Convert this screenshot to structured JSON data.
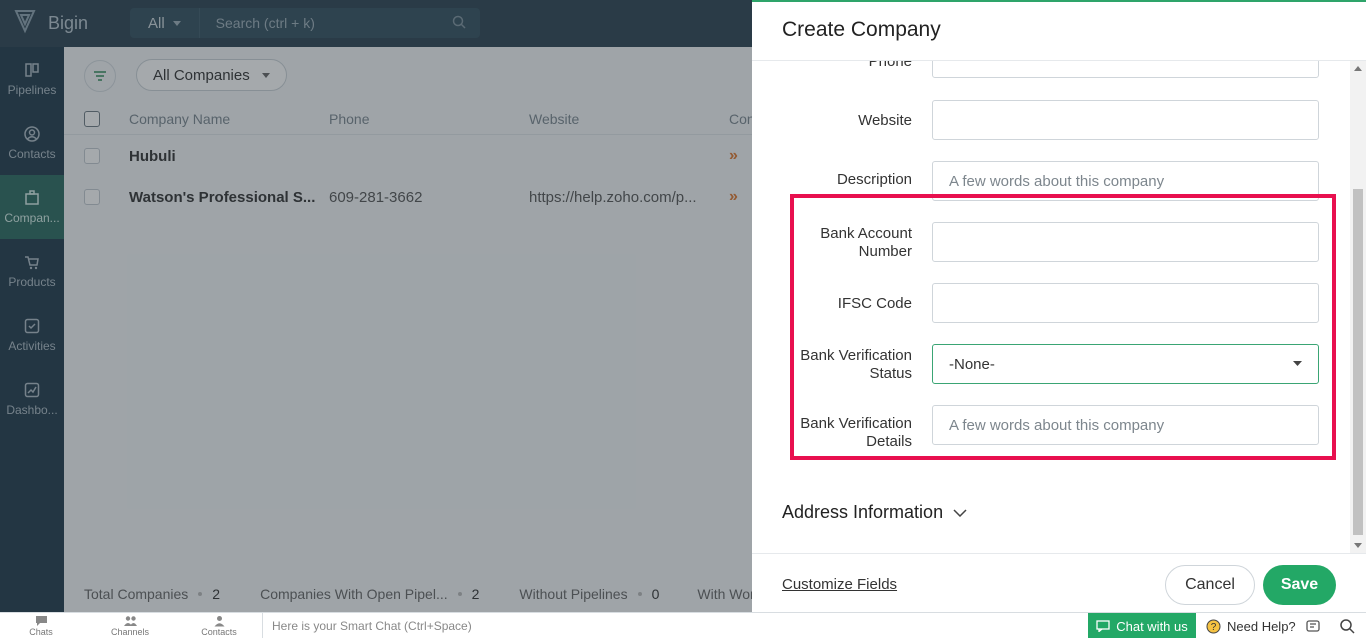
{
  "app": {
    "name": "Bigin"
  },
  "header": {
    "scope": "All",
    "search_placeholder": "Search (ctrl + k)"
  },
  "sidebar": {
    "items": [
      {
        "label": "Pipelines",
        "icon": "pipelines-icon"
      },
      {
        "label": "Contacts",
        "icon": "contacts-icon"
      },
      {
        "label": "Compan...",
        "icon": "companies-icon",
        "active": true
      },
      {
        "label": "Products",
        "icon": "products-icon"
      },
      {
        "label": "Activities",
        "icon": "activities-icon"
      },
      {
        "label": "Dashbo...",
        "icon": "dashboards-icon"
      }
    ]
  },
  "list": {
    "view_name": "All Companies",
    "columns": [
      "Company Name",
      "Phone",
      "Website",
      "Con"
    ],
    "rows": [
      {
        "name": "Hubuli",
        "phone": "",
        "website": ""
      },
      {
        "name": "Watson's Professional S...",
        "phone": "609-281-3662",
        "website": "https://help.zoho.com/p..."
      }
    ],
    "stats": [
      {
        "label": "Total Companies",
        "value": "2"
      },
      {
        "label": "Companies With Open Pipel...",
        "value": "2"
      },
      {
        "label": "Without Pipelines",
        "value": "0"
      },
      {
        "label": "With Won",
        "value": ""
      }
    ]
  },
  "panel": {
    "title": "Create Company",
    "fields": {
      "phone_label": "Phone",
      "website_label": "Website",
      "description_label": "Description",
      "description_placeholder": "A few words about this company",
      "bank_account_label_1": "Bank Account",
      "bank_account_label_2": "Number",
      "ifsc_label": "IFSC Code",
      "verification_status_label_1": "Bank Verification",
      "verification_status_label_2": "Status",
      "verification_status_value": "-None-",
      "verification_details_label_1": "Bank Verification",
      "verification_details_label_2": "Details",
      "verification_details_placeholder": "A few words about this company"
    },
    "section_address": "Address Information",
    "customize_fields": "Customize Fields",
    "cancel": "Cancel",
    "save": "Save",
    "highlight_color": "#e8104f"
  },
  "bottom_bar": {
    "items": [
      "Chats",
      "Channels",
      "Contacts"
    ],
    "smart_chat_placeholder": "Here is your Smart Chat (Ctrl+Space)",
    "chat_with_us": "Chat with us",
    "need_help": "Need Help?"
  },
  "colors": {
    "accent": "#23a866",
    "sidebar": "#1f3a4a",
    "topbar": "#2b4352"
  }
}
